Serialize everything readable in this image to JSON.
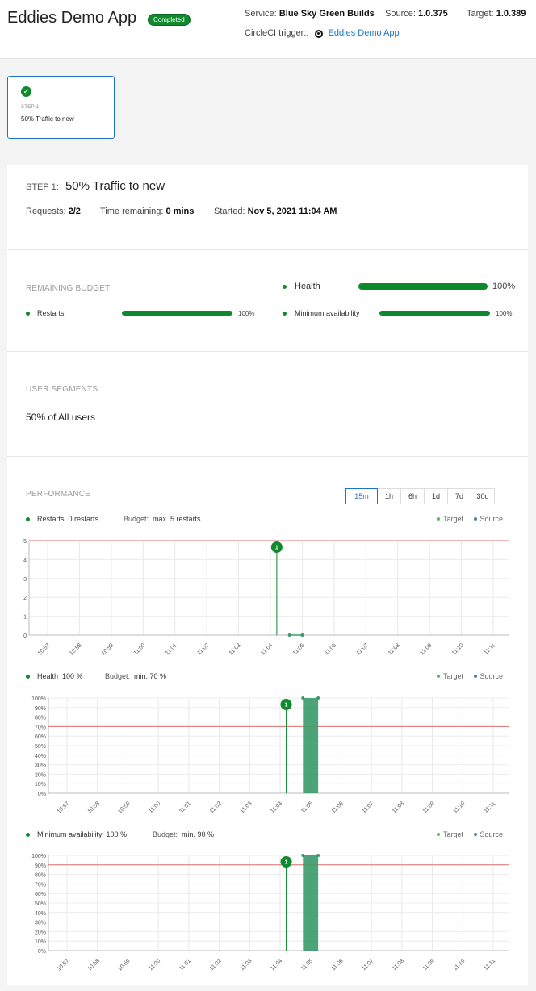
{
  "header": {
    "app_title": "Eddies Demo App",
    "status_badge": "Completed",
    "service_label": "Service:",
    "service_value": "Blue Sky Green Builds",
    "source_label": "Source:",
    "source_value": "1.0.375",
    "target_label": "Target:",
    "target_value": "1.0.389",
    "trigger_label": "CircleCI trigger::",
    "trigger_link": "Eddies Demo App",
    "trigger_icon": "circleci-icon"
  },
  "steps": [
    {
      "number": "STEP 1",
      "name": "50% Traffic to new",
      "status_icon": "check-icon"
    }
  ],
  "step_detail": {
    "label": "STEP 1:",
    "title": "50% Traffic to new",
    "requests_label": "Requests:",
    "requests_value": "2/2",
    "time_label": "Time remaining:",
    "time_value": "0 mins",
    "started_label": "Started:",
    "started_value": "Nov 5, 2021 11:04 AM"
  },
  "budget": {
    "title": "REMAINING BUDGET",
    "items": [
      {
        "label": "Health",
        "value": 100,
        "value_text": "100%"
      },
      {
        "label": "Restarts",
        "value": 100,
        "value_text": "100%"
      },
      {
        "label": "Minimum availability",
        "value": 100,
        "value_text": "100%"
      }
    ]
  },
  "segments": {
    "title": "USER SEGMENTS",
    "text": "50% of All users"
  },
  "performance": {
    "title": "PERFORMANCE",
    "ranges": [
      "15m",
      "1h",
      "6h",
      "1d",
      "7d",
      "30d"
    ],
    "active_range": "15m",
    "legend": [
      "Target",
      "Source"
    ]
  },
  "colors": {
    "accent": "#1f74c7",
    "green": "#118a2e",
    "bar_green": "#3a9a6a",
    "threshold": "#e07070",
    "source_dot": "#4a7fa8"
  },
  "chart_data": [
    {
      "type": "line",
      "title": "Restarts",
      "title_value": "0 restarts",
      "budget_label": "Budget:",
      "budget_value": "max. 5 restarts",
      "x": [
        "10:57",
        "10:58",
        "10:59",
        "11:00",
        "11:01",
        "11:02",
        "11:03",
        "11:04",
        "11:05",
        "11:06",
        "11:07",
        "11:08",
        "11:09",
        "11:10",
        "11:11"
      ],
      "yticks": [
        "0",
        "1",
        "2",
        "3",
        "4",
        "5"
      ],
      "ylim": [
        0,
        5
      ],
      "threshold": 5,
      "marker": {
        "x": 7.2,
        "label": "1"
      },
      "series": [
        {
          "name": "Target",
          "points": [
            [
              7.6,
              0
            ],
            [
              8.0,
              0
            ]
          ]
        }
      ],
      "bars": []
    },
    {
      "type": "bar",
      "title": "Health",
      "title_value": "100 %",
      "budget_label": "Budget:",
      "budget_value": "min. 70 %",
      "x": [
        "10:57",
        "10:58",
        "10:59",
        "11:00",
        "11:01",
        "11:02",
        "11:03",
        "11:04",
        "11:05",
        "11:06",
        "11:07",
        "11:08",
        "11:09",
        "11:10",
        "11:11"
      ],
      "yticks": [
        "0%",
        "10%",
        "20%",
        "30%",
        "40%",
        "50%",
        "60%",
        "70%",
        "80%",
        "90%",
        "100%"
      ],
      "ylim": [
        0,
        100
      ],
      "threshold": 70,
      "marker": {
        "x": 7.2,
        "label": "1"
      },
      "series": [],
      "bars": [
        {
          "x0": 7.75,
          "x1": 8.25,
          "value": 100
        }
      ]
    },
    {
      "type": "bar",
      "title": "Minimum availability",
      "title_value": "100 %",
      "budget_label": "Budget:",
      "budget_value": "min. 90 %",
      "x": [
        "10:57",
        "10:58",
        "10:59",
        "11:00",
        "11:01",
        "11:02",
        "11:03",
        "11:04",
        "11:05",
        "11:06",
        "11:07",
        "11:08",
        "11:09",
        "11:10",
        "11:11"
      ],
      "yticks": [
        "0%",
        "10%",
        "20%",
        "30%",
        "40%",
        "50%",
        "60%",
        "70%",
        "80%",
        "90%",
        "100%"
      ],
      "ylim": [
        0,
        100
      ],
      "threshold": 90,
      "marker": {
        "x": 7.2,
        "label": "1"
      },
      "series": [],
      "bars": [
        {
          "x0": 7.75,
          "x1": 8.25,
          "value": 100
        }
      ]
    }
  ]
}
